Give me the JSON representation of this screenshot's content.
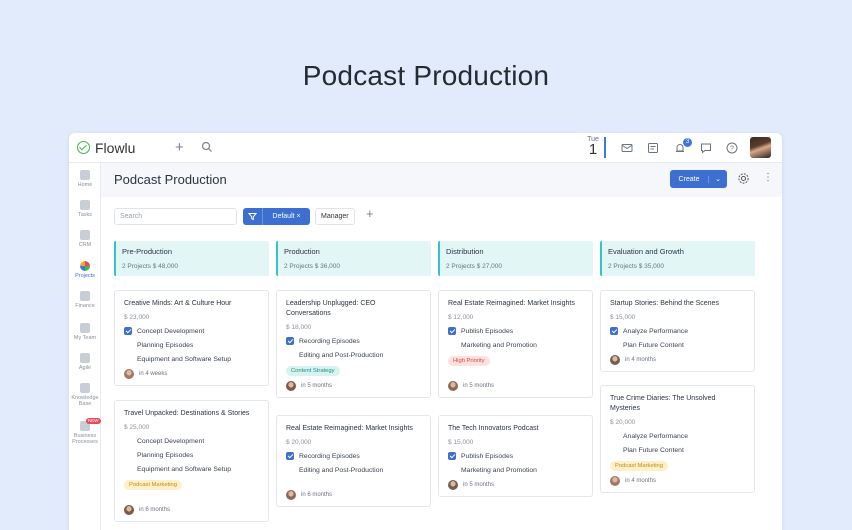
{
  "hero_title": "Podcast Production",
  "topbar": {
    "logo": "Flowlu",
    "date_day_name": "Tue",
    "date_day_number": "1",
    "notification_count": "3",
    "icons": [
      "plus-icon",
      "search-icon",
      "mail-icon",
      "notes-icon",
      "bell-icon",
      "chat-icon",
      "help-icon"
    ]
  },
  "sidebar": {
    "items": [
      {
        "label": "Home",
        "icon": "home-icon"
      },
      {
        "label": "Tasks",
        "icon": "tasks-icon"
      },
      {
        "label": "CRM",
        "icon": "crm-icon"
      },
      {
        "label": "Projects",
        "icon": "projects-icon",
        "active": true
      },
      {
        "label": "Finance",
        "icon": "finance-icon"
      },
      {
        "label": "My Team",
        "icon": "team-icon"
      },
      {
        "label": "Agile",
        "icon": "agile-icon"
      },
      {
        "label": "Knowledge Base",
        "icon": "knowledge-icon"
      },
      {
        "label": "Business Processes",
        "icon": "processes-icon",
        "badge": "NEW"
      }
    ]
  },
  "page": {
    "title": "Podcast Production",
    "create_label": "Create"
  },
  "toolbar": {
    "search_placeholder": "Search",
    "filter_label": "Default ×",
    "manager_label": "Manager"
  },
  "accent": "#3c6fcf",
  "columns": [
    {
      "name": "Pre-Production",
      "summary": "2 Projects  $ 48,000",
      "cards": [
        {
          "title": "Creative Minds: Art & Culture Hour",
          "price": "$ 23,000",
          "tasks": [
            {
              "t": "Concept Development",
              "done": true
            },
            {
              "t": "Planning Episodes",
              "done": false
            },
            {
              "t": "Equipment and Software Setup",
              "done": false
            }
          ],
          "tag": "",
          "due": "in 4 weeks"
        },
        {
          "title": "Travel Unpacked: Destinations & Stories",
          "price": "$ 25,000",
          "tasks": [
            {
              "t": "Concept Development",
              "done": false
            },
            {
              "t": "Planning Episodes",
              "done": false
            },
            {
              "t": "Equipment and Software Setup",
              "done": false
            }
          ],
          "tag": "Podcast Marketing",
          "due": "in 6 months"
        }
      ]
    },
    {
      "name": "Production",
      "summary": "2 Projects  $ 36,000",
      "cards": [
        {
          "title": "Leadership Unplugged: CEO Conversations",
          "price": "$ 18,000",
          "tasks": [
            {
              "t": "Recording Episodes",
              "done": true
            },
            {
              "t": "Editing and Post-Production",
              "done": false
            }
          ],
          "tag": "Content Strategy",
          "due": "in 5 months"
        },
        {
          "title": "Real Estate Reimagined: Market Insights",
          "price": "$ 20,000",
          "tasks": [
            {
              "t": "Recording Episodes",
              "done": true
            },
            {
              "t": "Editing and Post-Production",
              "done": false
            }
          ],
          "tag": "",
          "due": "in 6 months"
        }
      ]
    },
    {
      "name": "Distribution",
      "summary": "2 Projects  $ 27,000",
      "cards": [
        {
          "title": "Real Estate Reimagined: Market Insights",
          "price": "$ 12,000",
          "tasks": [
            {
              "t": "Publish Episodes",
              "done": true
            },
            {
              "t": "Marketing and Promotion",
              "done": false
            }
          ],
          "tag": "High Priority",
          "due": "in 5 months"
        },
        {
          "title": "The Tech Innovators Podcast",
          "price": "$ 15,000",
          "tasks": [
            {
              "t": "Publish Episodes",
              "done": true
            },
            {
              "t": "Marketing and Promotion",
              "done": false
            }
          ],
          "tag": "",
          "due": "in 5 months"
        }
      ]
    },
    {
      "name": "Evaluation and Growth",
      "summary": "2 Projects  $ 35,000",
      "cards": [
        {
          "title": "Startup Stories: Behind the Scenes",
          "price": "$ 15,000",
          "tasks": [
            {
              "t": "Analyze Performance",
              "done": true
            },
            {
              "t": "Plan Future Content",
              "done": false
            }
          ],
          "tag": "",
          "due": "in 4 months"
        },
        {
          "title": "True Crime Diaries: The Unsolved Mysteries",
          "price": "$ 20,000",
          "tasks": [
            {
              "t": "Analyze Performance",
              "done": false
            },
            {
              "t": "Plan Future Content",
              "done": false
            }
          ],
          "tag": "Podcast Marketing",
          "due": "in 4 months"
        }
      ]
    }
  ],
  "tag_styles": {
    "Podcast Marketing": {
      "bg": "#fdf0c9",
      "fg": "#c58a13"
    },
    "Content Strategy": {
      "bg": "#d6f3ef",
      "fg": "#1f8c7e"
    },
    "High Priority": {
      "bg": "#fde1de",
      "fg": "#d6483a"
    }
  }
}
